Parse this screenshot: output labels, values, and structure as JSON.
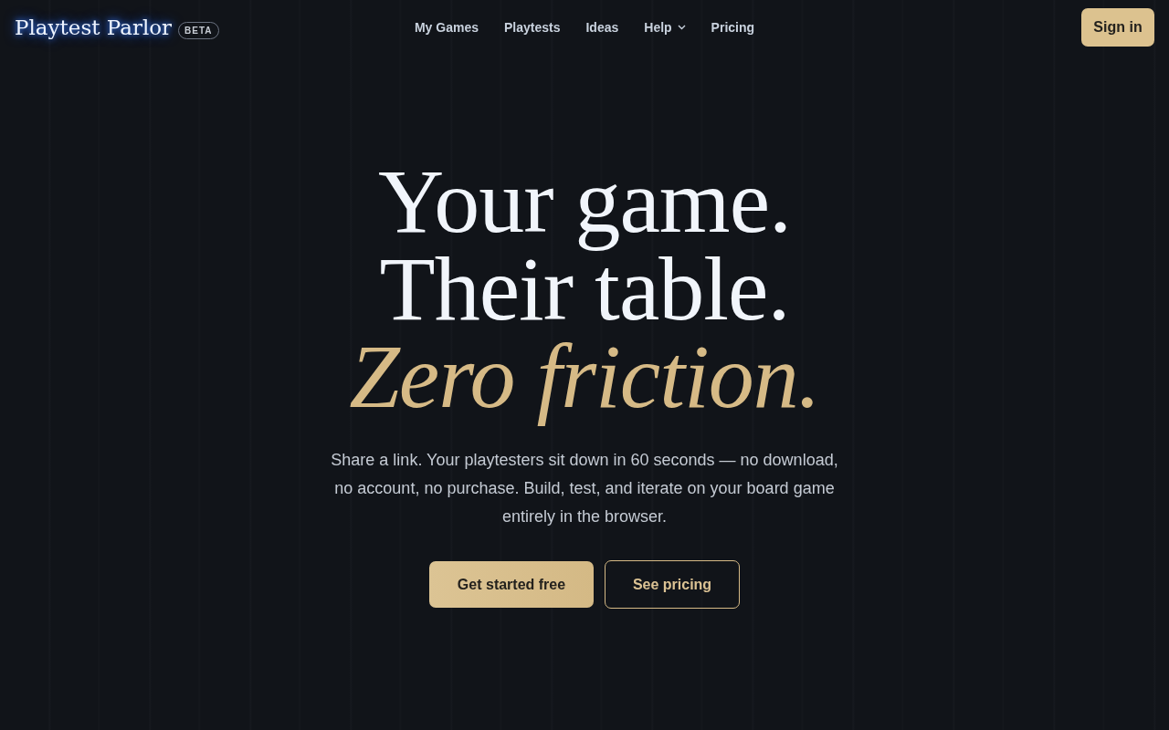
{
  "header": {
    "logo": {
      "name": "Playtest Parlor",
      "badge": "BETA"
    },
    "nav": [
      {
        "label": "My Games",
        "kind": "link"
      },
      {
        "label": "Playtests",
        "kind": "link"
      },
      {
        "label": "Ideas",
        "kind": "link"
      },
      {
        "label": "Help",
        "kind": "dropdown"
      },
      {
        "label": "Pricing",
        "kind": "link"
      }
    ],
    "sign_in": "Sign in"
  },
  "hero": {
    "headline": [
      {
        "text": "Your game.",
        "kind": "plain"
      },
      {
        "text": "Their table.",
        "kind": "plain"
      },
      {
        "text": "Zero friction.",
        "kind": "accent"
      }
    ],
    "description": "Share a link. Your playtesters sit down in 60 seconds — no download, no account, no purchase. Build, test, and iterate on your board game entirely in the browser.",
    "buttons": [
      {
        "label": "Get started free",
        "kind": "primary"
      },
      {
        "label": "See pricing",
        "kind": "outline"
      }
    ]
  }
}
